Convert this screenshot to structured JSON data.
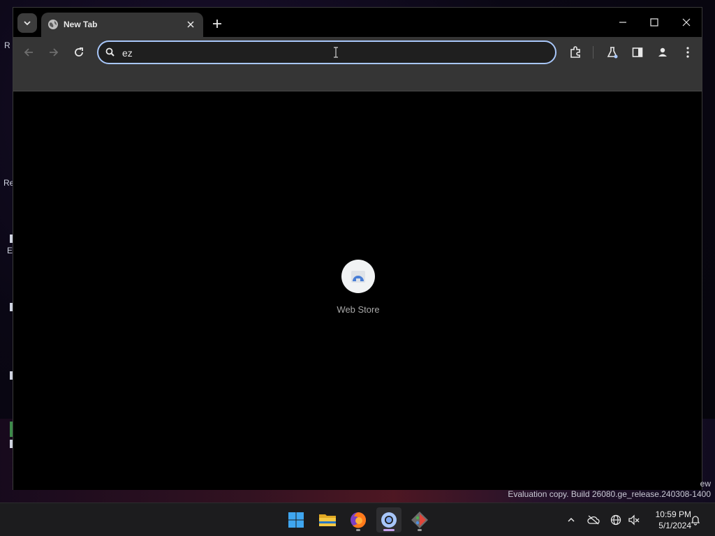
{
  "browser": {
    "tab": {
      "title": "New Tab"
    },
    "omnibox": {
      "value": "ez"
    },
    "shortcuts": [
      {
        "label": "Web Store"
      }
    ]
  },
  "desktop": {
    "edge_labels": [
      "R",
      "Re",
      "E"
    ],
    "watermark_top": "ew",
    "watermark": "Evaluation copy. Build 26080.ge_release.240308-1400"
  },
  "taskbar": {
    "apps": [
      "start-icon",
      "file-explorer-icon",
      "firefox-icon",
      "chrome-icon",
      "git-tool-icon"
    ],
    "clock": {
      "time": "10:59 PM",
      "date": "5/1/2024"
    }
  },
  "colors": {
    "focus_ring": "#a8c7fa",
    "toolbar": "#353535",
    "active_indicator": "#c7a2f0"
  }
}
